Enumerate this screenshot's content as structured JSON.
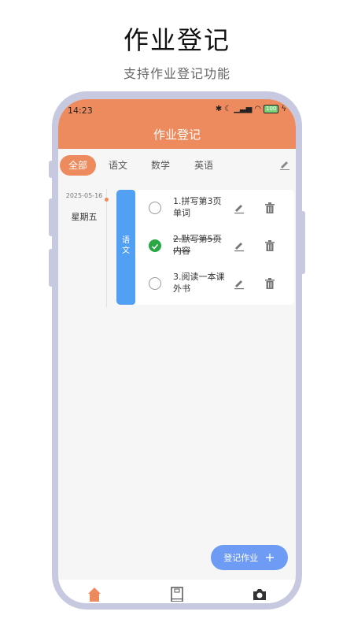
{
  "promo": {
    "title": "作业登记",
    "subtitle": "支持作业登记功能"
  },
  "status_bar": {
    "time": "14:23",
    "battery": "100"
  },
  "header": {
    "title": "作业登记"
  },
  "tabs": [
    {
      "label": "全部",
      "active": true
    },
    {
      "label": "语文",
      "active": false
    },
    {
      "label": "数学",
      "active": false
    },
    {
      "label": "英语",
      "active": false
    }
  ],
  "day": {
    "date": "2025-05-16",
    "weekday": "星期五"
  },
  "subject": {
    "label_line1": "语",
    "label_line2": "文",
    "color": "#52a0f3"
  },
  "tasks": [
    {
      "text": "1.拼写第3页单词",
      "done": false
    },
    {
      "text": "2.默写第5页内容",
      "done": true
    },
    {
      "text": "3.阅读一本课外书",
      "done": false
    }
  ],
  "fab": {
    "label": "登记作业",
    "icon": "plus-icon"
  },
  "bottom_nav": {
    "items": [
      "home-icon",
      "notebook-icon",
      "camera-icon"
    ],
    "active": "home-icon"
  },
  "colors": {
    "accent": "#ee8b5e",
    "fab": "#6e9cf5",
    "done": "#28a745"
  }
}
